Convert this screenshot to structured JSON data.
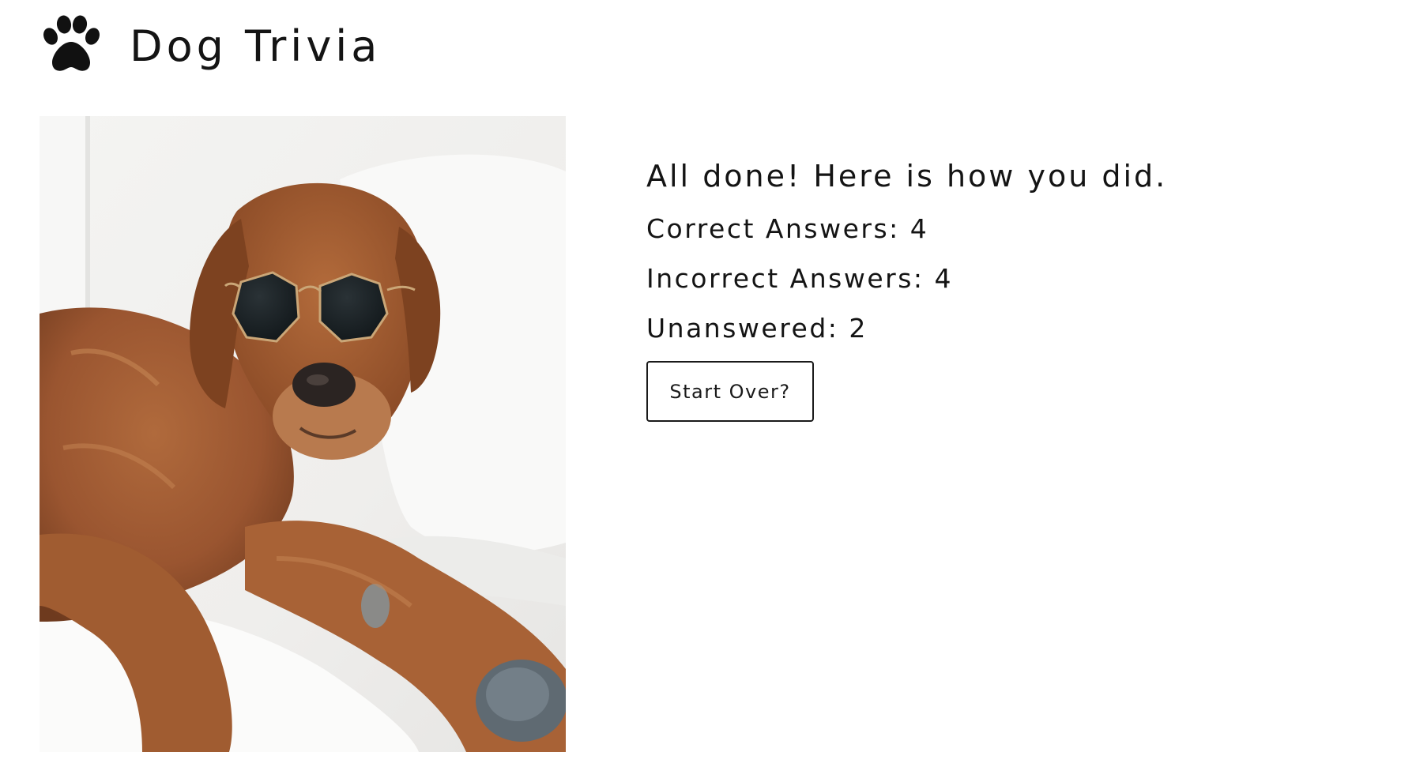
{
  "header": {
    "title": "Dog Trivia",
    "logo_icon": "paw-icon"
  },
  "photo": {
    "subject": "dog-photo"
  },
  "results": {
    "heading": "All done! Here is how you did.",
    "correct": "Correct Answers: 4",
    "incorrect": "Incorrect Answers: 4",
    "unanswered": "Unanswered: 2",
    "start_over_label": "Start Over?"
  },
  "colors": {
    "text": "#141414",
    "background": "#ffffff",
    "fur": "#9a5530"
  }
}
